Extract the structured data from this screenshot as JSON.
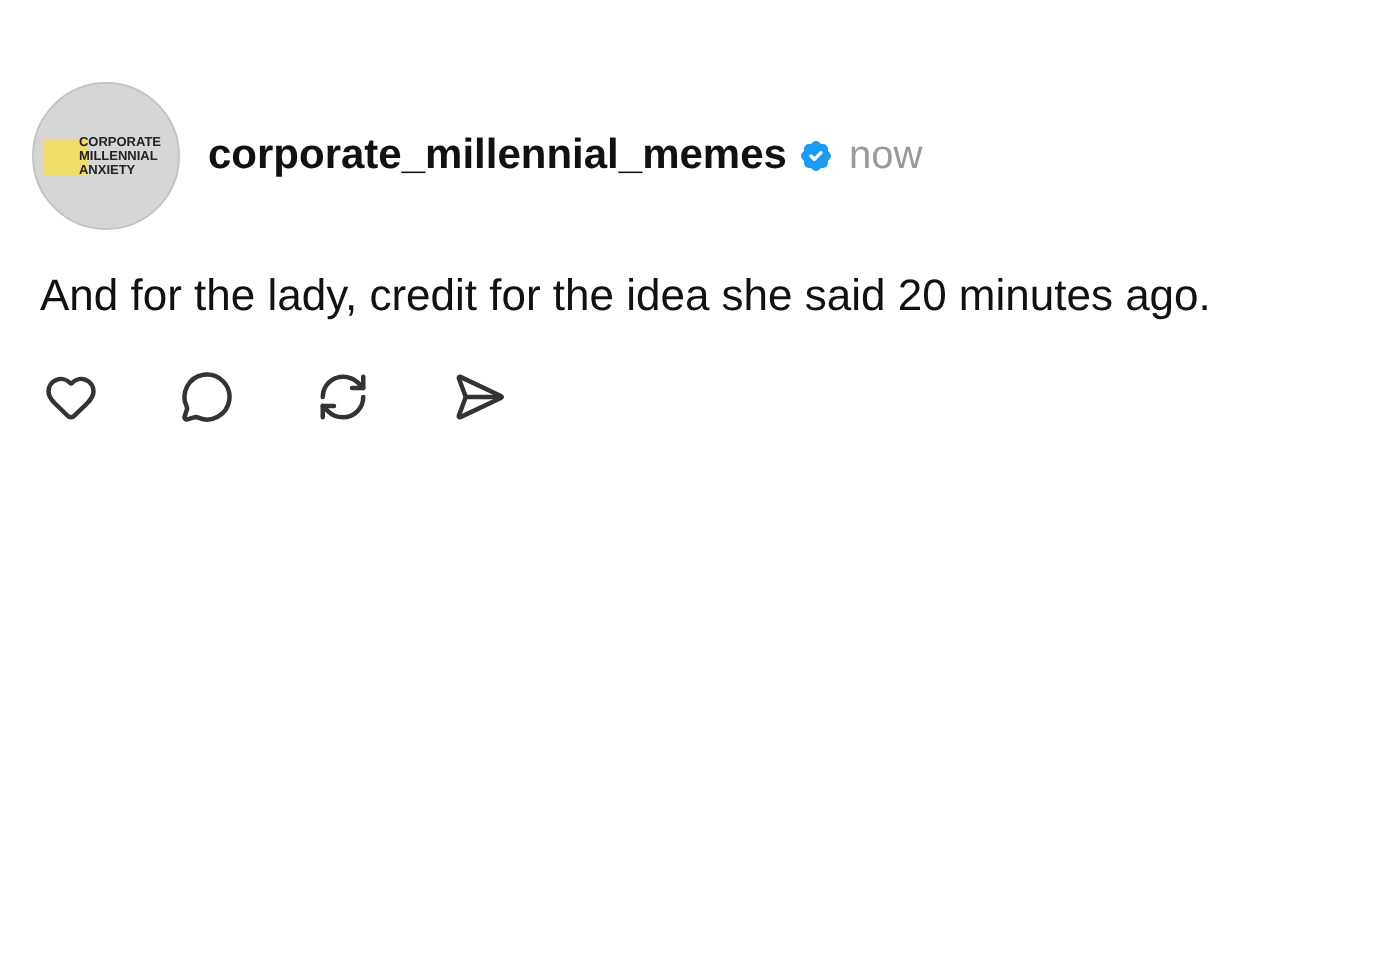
{
  "post": {
    "avatar": {
      "logo_lines": [
        "CORPORATE",
        "MILLENNIAL",
        "ANXIETY"
      ]
    },
    "username": "corporate_millennial_memes",
    "verified": true,
    "time": "now",
    "text": "And for the lady, credit for the idea she said 20 minutes ago.",
    "actions": [
      {
        "kind": "like"
      },
      {
        "kind": "reply"
      },
      {
        "kind": "repost"
      },
      {
        "kind": "share"
      }
    ]
  }
}
